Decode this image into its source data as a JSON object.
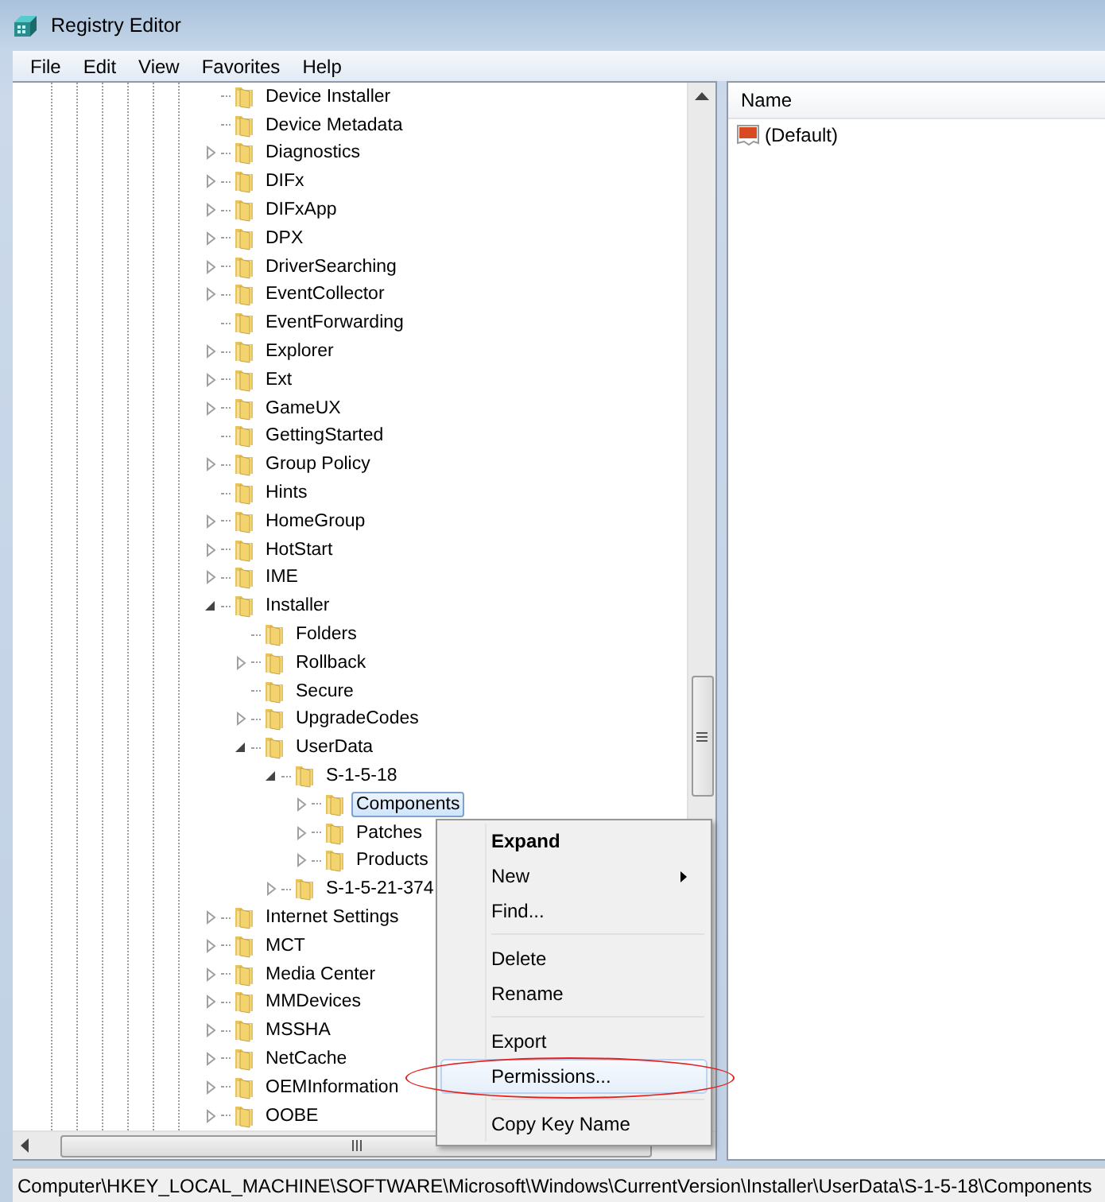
{
  "window": {
    "title": "Registry Editor"
  },
  "menu": [
    "File",
    "Edit",
    "View",
    "Favorites",
    "Help"
  ],
  "tree": [
    {
      "label": "Device Installer",
      "expandable": false,
      "selected": false
    },
    {
      "label": "Device Metadata",
      "expandable": false,
      "selected": false
    },
    {
      "label": "Diagnostics",
      "expandable": true,
      "expanded": false,
      "selected": false
    },
    {
      "label": "DIFx",
      "expandable": true,
      "expanded": false,
      "selected": false
    },
    {
      "label": "DIFxApp",
      "expandable": true,
      "expanded": false,
      "selected": false
    },
    {
      "label": "DPX",
      "expandable": true,
      "expanded": false,
      "selected": false
    },
    {
      "label": "DriverSearching",
      "expandable": true,
      "expanded": false,
      "selected": false
    },
    {
      "label": "EventCollector",
      "expandable": true,
      "expanded": false,
      "selected": false
    },
    {
      "label": "EventForwarding",
      "expandable": false,
      "selected": false
    },
    {
      "label": "Explorer",
      "expandable": true,
      "expanded": false,
      "selected": false
    },
    {
      "label": "Ext",
      "expandable": true,
      "expanded": false,
      "selected": false
    },
    {
      "label": "GameUX",
      "expandable": true,
      "expanded": false,
      "selected": false
    },
    {
      "label": "GettingStarted",
      "expandable": false,
      "selected": false
    },
    {
      "label": "Group Policy",
      "expandable": true,
      "expanded": false,
      "selected": false
    },
    {
      "label": "Hints",
      "expandable": false,
      "selected": false
    },
    {
      "label": "HomeGroup",
      "expandable": true,
      "expanded": false,
      "selected": false
    },
    {
      "label": "HotStart",
      "expandable": true,
      "expanded": false,
      "selected": false
    },
    {
      "label": "IME",
      "expandable": true,
      "expanded": false,
      "selected": false
    },
    {
      "label": "Installer",
      "expandable": true,
      "expanded": true,
      "selected": false,
      "children": [
        {
          "label": "Folders",
          "expandable": false,
          "selected": false
        },
        {
          "label": "Rollback",
          "expandable": true,
          "expanded": false,
          "selected": false
        },
        {
          "label": "Secure",
          "expandable": false,
          "selected": false
        },
        {
          "label": "UpgradeCodes",
          "expandable": true,
          "expanded": false,
          "selected": false
        },
        {
          "label": "UserData",
          "expandable": true,
          "expanded": true,
          "selected": false,
          "children": [
            {
              "label": "S-1-5-18",
              "expandable": true,
              "expanded": true,
              "selected": false,
              "children": [
                {
                  "label": "Components",
                  "expandable": true,
                  "expanded": false,
                  "selected": true
                },
                {
                  "label": "Patches",
                  "expandable": true,
                  "expanded": false,
                  "selected": false
                },
                {
                  "label": "Products",
                  "expandable": true,
                  "expanded": false,
                  "selected": false
                }
              ]
            },
            {
              "label": "S-1-5-21-374",
              "expandable": true,
              "expanded": false,
              "selected": false
            }
          ]
        }
      ]
    },
    {
      "label": "Internet Settings",
      "expandable": true,
      "expanded": false,
      "selected": false
    },
    {
      "label": "MCT",
      "expandable": true,
      "expanded": false,
      "selected": false
    },
    {
      "label": "Media Center",
      "expandable": true,
      "expanded": false,
      "selected": false
    },
    {
      "label": "MMDevices",
      "expandable": true,
      "expanded": false,
      "selected": false
    },
    {
      "label": "MSSHA",
      "expandable": true,
      "expanded": false,
      "selected": false
    },
    {
      "label": "NetCache",
      "expandable": true,
      "expanded": false,
      "selected": false
    },
    {
      "label": "OEMInformation",
      "expandable": true,
      "expanded": false,
      "selected": false
    },
    {
      "label": "OOBE",
      "expandable": true,
      "expanded": false,
      "selected": false
    }
  ],
  "values": {
    "columns": [
      "Name"
    ],
    "rows": [
      {
        "name": "(Default)"
      }
    ]
  },
  "context_menu": [
    {
      "kind": "item",
      "label": "Expand",
      "bold": true,
      "submenu": false,
      "selected": false
    },
    {
      "kind": "item",
      "label": "New",
      "bold": false,
      "submenu": true,
      "selected": false
    },
    {
      "kind": "item",
      "label": "Find...",
      "bold": false,
      "submenu": false,
      "selected": false
    },
    {
      "kind": "separator"
    },
    {
      "kind": "item",
      "label": "Delete",
      "bold": false,
      "submenu": false,
      "selected": false
    },
    {
      "kind": "item",
      "label": "Rename",
      "bold": false,
      "submenu": false,
      "selected": false
    },
    {
      "kind": "separator"
    },
    {
      "kind": "item",
      "label": "Export",
      "bold": false,
      "submenu": false,
      "selected": false
    },
    {
      "kind": "item",
      "label": "Permissions...",
      "bold": false,
      "submenu": false,
      "selected": true,
      "circled": true
    },
    {
      "kind": "separator"
    },
    {
      "kind": "item",
      "label": "Copy Key Name",
      "bold": false,
      "submenu": false,
      "selected": false
    }
  ],
  "status_bar": "Computer\\HKEY_LOCAL_MACHINE\\SOFTWARE\\Microsoft\\Windows\\CurrentVersion\\Installer\\UserData\\S-1-5-18\\Components"
}
